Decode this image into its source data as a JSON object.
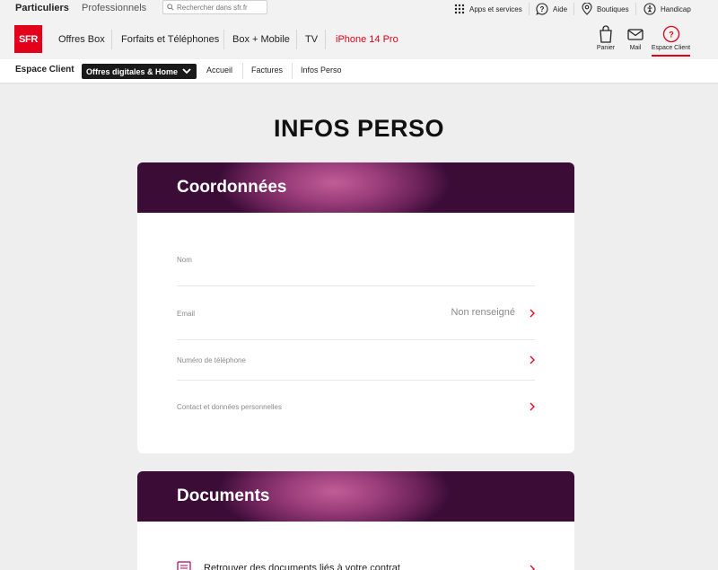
{
  "topbar": {
    "segment_active": "Particuliers",
    "segment_inactive": "Professionnels",
    "search_placeholder": "Rechercher dans sfr.fr",
    "utilities": [
      {
        "label": "Apps et services",
        "icon": "grid-icon"
      },
      {
        "label": "Aide",
        "icon": "help-icon"
      },
      {
        "label": "Boutiques",
        "icon": "location-pin-icon"
      },
      {
        "label": "Handicap",
        "icon": "accessibility-icon"
      }
    ]
  },
  "header": {
    "logo_text": "SFR",
    "nav": [
      "Offres Box",
      "Forfaits et Téléphones",
      "Box + Mobile",
      "TV",
      "iPhone 14 Pro"
    ],
    "icons": [
      {
        "label": "Panier",
        "icon": "cart-icon"
      },
      {
        "label": "Mail",
        "icon": "mail-icon"
      },
      {
        "label": "Espace Client",
        "icon": "account-icon"
      }
    ],
    "accent_color": "#e2001a"
  },
  "subnav": {
    "title": "Espace Client",
    "dropdown_label": "Offres digitales & Home",
    "links": [
      "Accueil",
      "Factures",
      "Infos Perso"
    ]
  },
  "page": {
    "title": "INFOS PERSO"
  },
  "coordonnees": {
    "title": "Coordonnées",
    "rows": [
      {
        "label": "Nom",
        "value": ""
      },
      {
        "label": "Email",
        "value": "Non renseigné"
      },
      {
        "label": "Numéro de téléphone",
        "value": ""
      },
      {
        "label": "Contact et données personnelles",
        "value": ""
      }
    ]
  },
  "documents": {
    "title": "Documents",
    "item_label": "Retrouver des documents liés à votre contrat"
  }
}
